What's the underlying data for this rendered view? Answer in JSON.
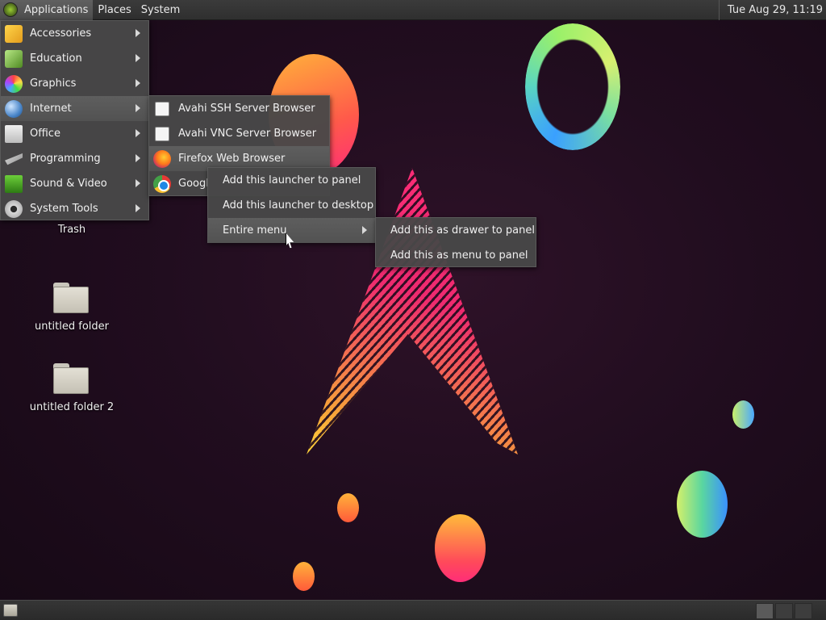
{
  "top_panel": {
    "menus": [
      "Applications",
      "Places",
      "System"
    ],
    "clock": "Tue Aug 29, 11:19"
  },
  "desktop": {
    "icons": [
      {
        "label": "Trash",
        "icon": "trash-icon"
      },
      {
        "label": "untitled folder",
        "icon": "folder-icon"
      },
      {
        "label": "untitled folder 2",
        "icon": "folder-icon"
      }
    ]
  },
  "applications_menu": {
    "highlighted": "Internet",
    "items": [
      {
        "label": "Accessories",
        "icon": "accessories-icon"
      },
      {
        "label": "Education",
        "icon": "education-icon"
      },
      {
        "label": "Graphics",
        "icon": "graphics-icon"
      },
      {
        "label": "Internet",
        "icon": "internet-globe-icon"
      },
      {
        "label": "Office",
        "icon": "office-icon"
      },
      {
        "label": "Programming",
        "icon": "programming-icon"
      },
      {
        "label": "Sound & Video",
        "icon": "sound-video-icon"
      },
      {
        "label": "System Tools",
        "icon": "system-tools-icon"
      }
    ]
  },
  "internet_submenu": {
    "highlighted": "Firefox Web Browser",
    "items": [
      {
        "label": "Avahi SSH Server Browser",
        "icon": "avahi-icon"
      },
      {
        "label": "Avahi VNC Server Browser",
        "icon": "avahi-icon"
      },
      {
        "label": "Firefox Web Browser",
        "icon": "firefox-icon"
      },
      {
        "label": "Googl",
        "icon": "chrome-icon"
      }
    ]
  },
  "context_menu": {
    "highlighted": "Entire menu",
    "items": [
      {
        "label": "Add this launcher to panel"
      },
      {
        "label": "Add this launcher to desktop"
      },
      {
        "label": "Entire menu"
      }
    ]
  },
  "entire_menu_submenu": {
    "items": [
      {
        "label": "Add this as drawer to panel"
      },
      {
        "label": "Add this as menu to panel"
      }
    ]
  },
  "colors": {
    "panel_bg": "#333333",
    "menu_bg": "#484848",
    "menu_highlight": "#585858",
    "wallpaper_bg": "#210d1f",
    "arch_pink": "#ff2d78",
    "arch_yellow": "#ffd23a"
  }
}
